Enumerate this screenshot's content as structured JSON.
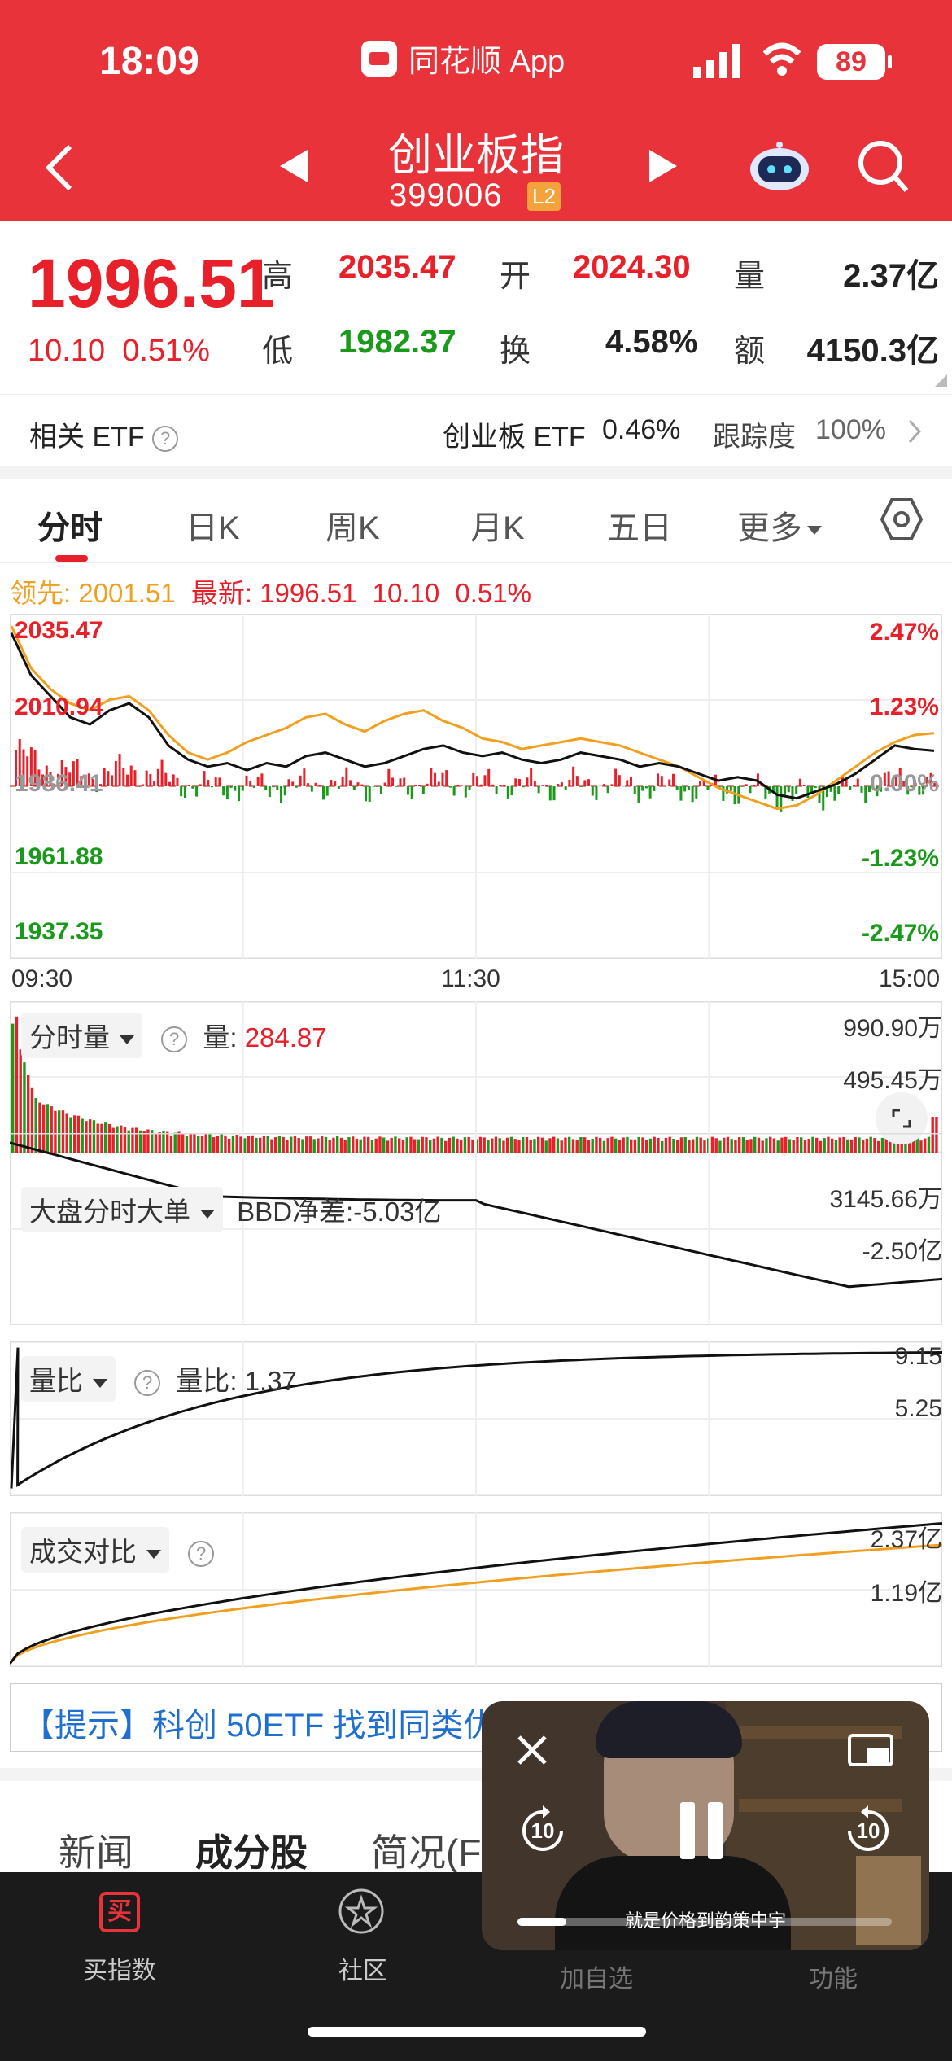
{
  "status_bar": {
    "time": "18:09",
    "app": "同花顺 App",
    "battery": "89"
  },
  "header": {
    "title": "创业板指",
    "code": "399006",
    "level": "L2"
  },
  "quote": {
    "price": "1996.51",
    "change": "10.10",
    "change_pct": "0.51%",
    "high_label": "高",
    "high": "2035.47",
    "open_label": "开",
    "open": "2024.30",
    "volume_label": "量",
    "volume": "2.37亿",
    "low_label": "低",
    "low": "1982.37",
    "turnover_label": "换",
    "turnover": "4.58%",
    "amount_label": "额",
    "amount": "4150.3亿"
  },
  "etf": {
    "label": "相关 ETF",
    "name": "创业板 ETF",
    "pct": "0.46%",
    "track_label": "跟踪度",
    "track": "100%"
  },
  "tabs": [
    "分时",
    "日K",
    "周K",
    "月K",
    "五日",
    "更多"
  ],
  "legend": {
    "lead_label": "领先:",
    "lead": "2001.51",
    "latest_label": "最新:",
    "latest": "1996.51",
    "chg": "10.10",
    "pct": "0.51%"
  },
  "chart_data": [
    {
      "type": "line",
      "title": "分时",
      "x_ticks": [
        "09:30",
        "11:30",
        "15:00"
      ],
      "y_left_ticks": [
        "2035.47",
        "2010.94",
        "1986.41",
        "1961.88",
        "1937.35"
      ],
      "y_right_ticks": [
        "2.47%",
        "1.23%",
        "0.00%",
        "-1.23%",
        "-2.47%"
      ],
      "ylim": [
        1937.35,
        2035.47
      ],
      "series": [
        {
          "name": "最新",
          "color": "#111111",
          "values": [
            2030,
            2018,
            2012,
            2006,
            2004,
            2008,
            2010,
            2006,
            1998,
            1994,
            1992,
            1993,
            1991,
            1993,
            1992,
            1995,
            1996,
            1994,
            1992,
            1993,
            1995,
            1997,
            1998,
            1996,
            1995,
            1996,
            1994,
            1993,
            1994,
            1996,
            1995,
            1994,
            1992,
            1993,
            1992,
            1990,
            1988,
            1989,
            1988,
            1984,
            1983,
            1985,
            1987,
            1990,
            1994,
            1998,
            1997,
            1996.51
          ]
        },
        {
          "name": "领先",
          "color": "#f0a020",
          "values": [
            2032,
            2020,
            2014,
            2010,
            2008,
            2011,
            2012,
            2008,
            2001,
            1996,
            1994,
            1996,
            1999,
            2001,
            2003,
            2006,
            2007,
            2004,
            2002,
            2005,
            2007,
            2008,
            2005,
            2003,
            2000,
            1999,
            1997,
            1998,
            1999,
            2000,
            1999,
            1998,
            1996,
            1994,
            1992,
            1989,
            1986,
            1984,
            1982,
            1980,
            1981,
            1984,
            1988,
            1992,
            1996,
            1999,
            2001,
            2001.51
          ]
        }
      ]
    },
    {
      "type": "bar",
      "title": "分时量",
      "volume_label": "量:",
      "volume": "284.87",
      "y_ticks": [
        "990.90万",
        "495.45万"
      ]
    },
    {
      "type": "line",
      "title": "大盘分时大单",
      "bbd_label": "BBD净差:",
      "bbd": "-5.03亿",
      "y_ticks": [
        "3145.66万",
        "-2.50亿"
      ]
    },
    {
      "type": "line",
      "title": "量比",
      "ratio_label": "量比:",
      "ratio": "1.37",
      "y_ticks": [
        "9.15",
        "5.25"
      ]
    },
    {
      "type": "line",
      "title": "成交对比",
      "y_ticks": [
        "2.37亿",
        "1.19亿"
      ]
    }
  ],
  "tip": "【提示】科创 50ETF 找到同类优",
  "bottom_tabs": [
    "新闻",
    "成分股",
    "简况(F"
  ],
  "nav": [
    "买指数",
    "社区",
    "加自选",
    "功能"
  ],
  "nav_badge": "买",
  "video": {
    "subtitle": "就是价格到韵策中宇",
    "rewind": "10",
    "forward": "10"
  },
  "colors": {
    "brand": "#e8333b",
    "up": "#e8202a",
    "down": "#1a9a1a",
    "lead": "#f0a020"
  }
}
